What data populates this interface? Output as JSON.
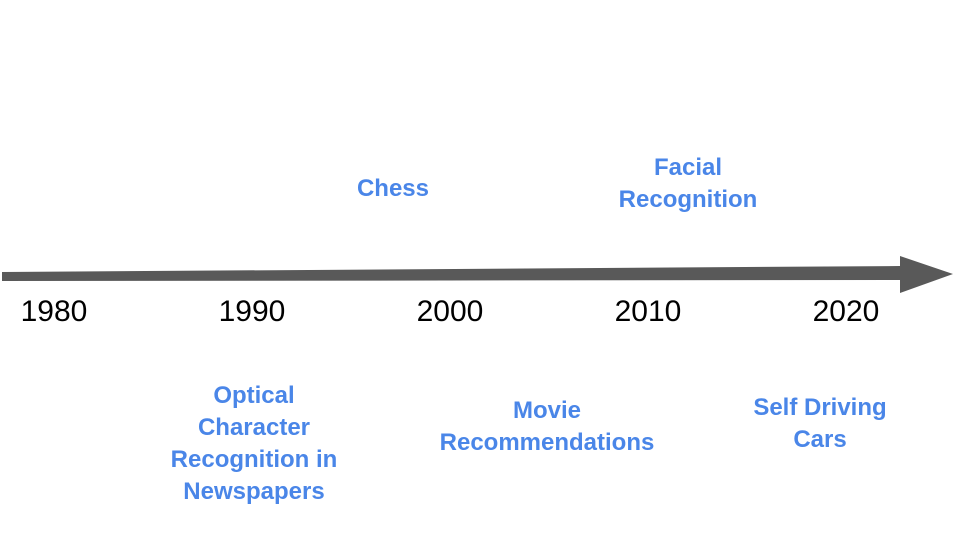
{
  "colors": {
    "axis": "#595959",
    "event_text": "#4a86e8",
    "year_text": "#000000",
    "background": "#ffffff"
  },
  "timeline": {
    "years": [
      "1980",
      "1990",
      "2000",
      "2010",
      "2020"
    ],
    "events_above": [
      {
        "label": "Chess",
        "year_near": "1995"
      },
      {
        "label": "Facial\nRecognition",
        "year_near": "2012"
      }
    ],
    "events_below": [
      {
        "label": "Optical\nCharacter\nRecognition in\nNewspapers",
        "year_near": "1990"
      },
      {
        "label": "Movie\nRecommendations",
        "year_near": "2005"
      },
      {
        "label": "Self Driving\nCars",
        "year_near": "2020"
      }
    ]
  }
}
